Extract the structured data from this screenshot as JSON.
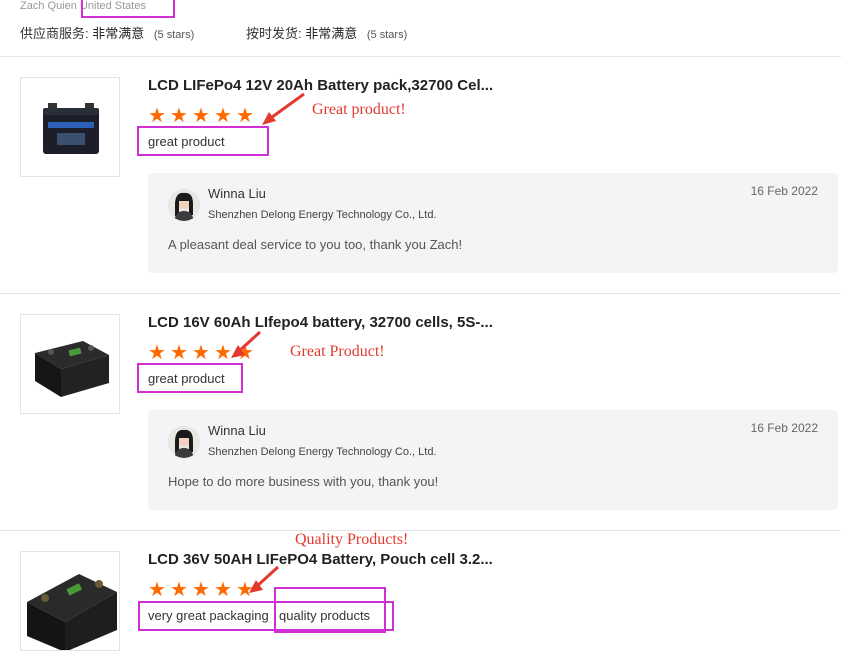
{
  "header": {
    "buyer_name": "Zach Quien",
    "buyer_country": "United States",
    "supplier_service_label": "供应商服务:",
    "supplier_service_value": "非常满意",
    "supplier_service_stars": "(5 stars)",
    "ontime_label": "按时发货:",
    "ontime_value": "非常满意",
    "ontime_stars": "(5 stars)"
  },
  "reviews": [
    {
      "title": "LCD LIFePo4 12V 20Ah Battery pack,32700 Cel...",
      "rating": 5,
      "annotation": "Great product!",
      "tags": [
        "great product"
      ],
      "reply": {
        "name": "Winna Liu",
        "company": "Shenzhen Delong Energy Technology Co., Ltd.",
        "date": "16 Feb 2022",
        "text": "A pleasant deal service to you too, thank you Zach!"
      }
    },
    {
      "title": "LCD 16V 60Ah LIfepo4 battery, 32700 cells, 5S-...",
      "rating": 5,
      "annotation": "Great Product!",
      "tags": [
        "great product"
      ],
      "reply": {
        "name": "Winna Liu",
        "company": "Shenzhen Delong Energy Technology Co., Ltd.",
        "date": "16 Feb 2022",
        "text": "Hope to do more business with you,  thank you!"
      }
    },
    {
      "title": "LCD 36V 50AH LIFePO4 Battery, Pouch cell 3.2...",
      "rating": 5,
      "annotation": "Quality Products!",
      "tags": [
        "very great packaging",
        "quality products"
      ]
    }
  ],
  "colors": {
    "star": "#ff6a00",
    "annotation": "#e23a2f",
    "highlight_box": "#d12fd6"
  },
  "icons": [
    "star-icon",
    "arrow-icon",
    "avatar"
  ]
}
